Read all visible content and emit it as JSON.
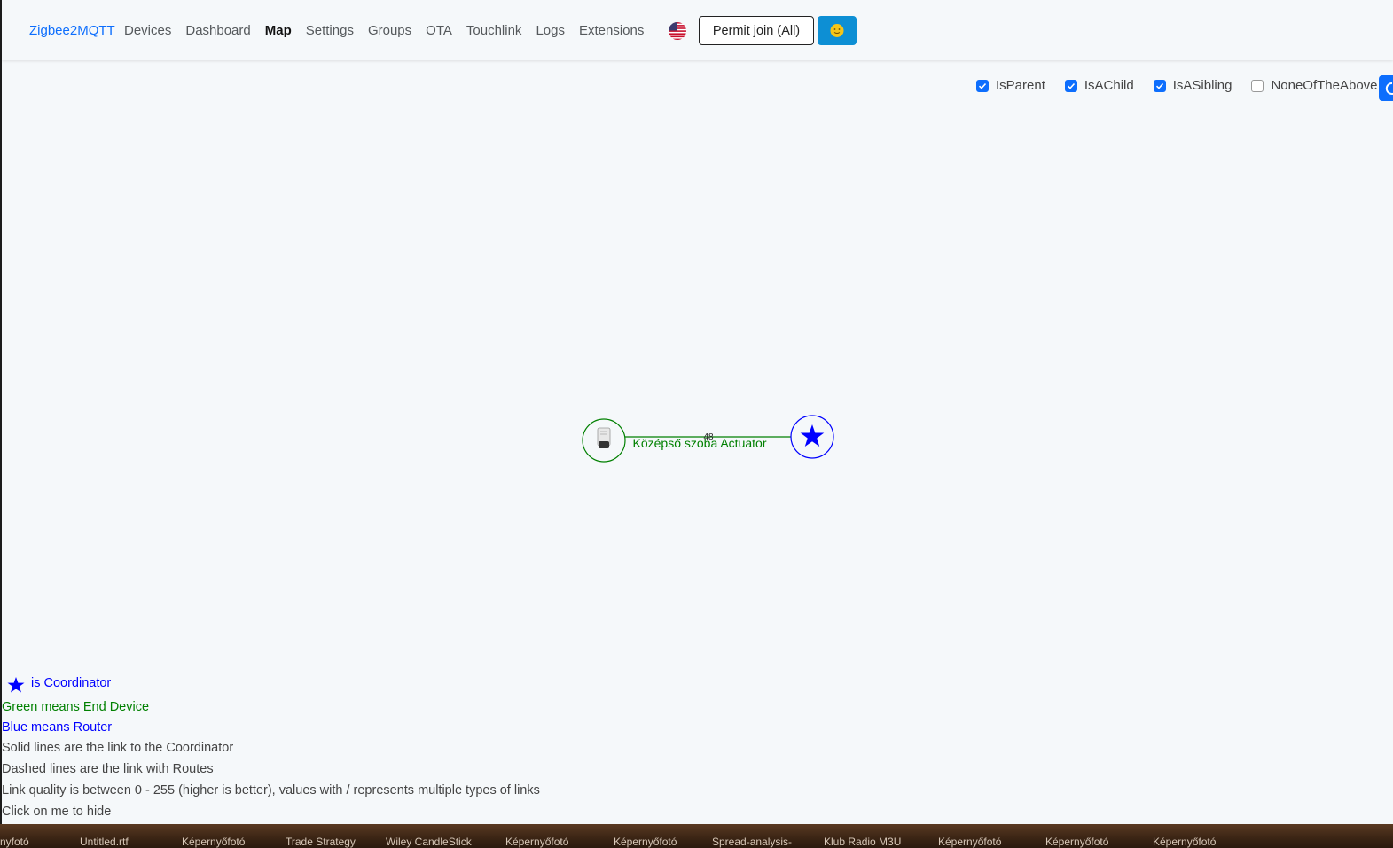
{
  "navbar": {
    "brand": "Zigbee2MQTT",
    "links": [
      "Devices",
      "Dashboard",
      "Map",
      "Settings",
      "Groups",
      "OTA",
      "Touchlink",
      "Logs",
      "Extensions"
    ],
    "active_link": "Map",
    "permit_join_label": "Permit join (All)",
    "language_flag": "us-flag-icon",
    "theme_icon": "sun-face-icon"
  },
  "filters": [
    {
      "label": "IsParent",
      "checked": true
    },
    {
      "label": "IsAChild",
      "checked": true
    },
    {
      "label": "IsASibling",
      "checked": true
    },
    {
      "label": "NoneOfTheAbove",
      "checked": false
    }
  ],
  "map": {
    "end_device": {
      "label": "Középső szoba Actuator",
      "icon": "radiator-valve-icon",
      "color": "#008000"
    },
    "coordinator": {
      "icon": "star-icon",
      "color": "#0000ff"
    },
    "link": {
      "quality_label": "48",
      "color": "#008000"
    }
  },
  "legend": {
    "coordinator": "is Coordinator",
    "green": "Green means End Device",
    "blue": "Blue means Router",
    "solid": "Solid lines are the link to the Coordinator",
    "dashed": "Dashed lines are the link with Routes",
    "quality": "Link quality is between 0 - 255 (higher is better), values with / represents multiple types of links",
    "hide": "Click on me to hide"
  },
  "taskbar": [
    "nyfotó",
    "Untitled.rtf",
    "Képernyőfotó",
    "Trade Strategy",
    "Wiley CandleStick",
    "Képernyőfotó",
    "Képernyőfotó",
    "Spread-analysis-",
    "Klub Radio M3U",
    "Képernyőfotó",
    "Képernyőfotó",
    "Képernyőfotó"
  ],
  "colors": {
    "accent": "#0d6efd",
    "end_device": "#008000",
    "router": "#0000ff",
    "text": "#444444"
  }
}
